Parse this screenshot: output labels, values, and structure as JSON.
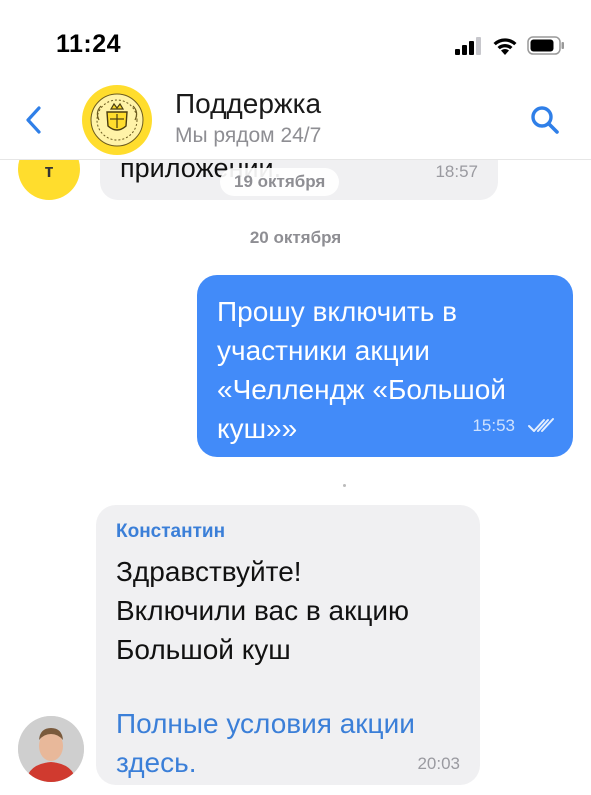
{
  "status_bar": {
    "time": "11:24",
    "icons": [
      "signal-icon",
      "wifi-icon",
      "battery-icon"
    ]
  },
  "header": {
    "back_icon": "chevron-left-icon",
    "title": "Поддержка",
    "subtitle": "Мы рядом 24/7",
    "search_icon": "search-icon"
  },
  "messages": {
    "previous": {
      "text": "приложении.",
      "time": "18:57"
    },
    "floating_date": "19 октября",
    "date_separator": "20 октября",
    "outgoing": {
      "text": "Прошу включить в участники акции «Челлендж «Большой куш»»",
      "time": "15:53",
      "status_icon": "double-check-icon"
    },
    "incoming": {
      "sender": "Константин",
      "text_line1": "Здравствуйте!",
      "text_line2": "Включили вас в акцию",
      "text_line3": "Большой куш",
      "link_text": "Полные условия акции здесь.",
      "time": "20:03"
    }
  },
  "colors": {
    "brand_yellow": "#ffdd2d",
    "accent_blue": "#428bf9",
    "link_blue": "#3b7fd8",
    "incoming_bubble": "#f0f0f2",
    "secondary_text": "#8e8e93"
  }
}
